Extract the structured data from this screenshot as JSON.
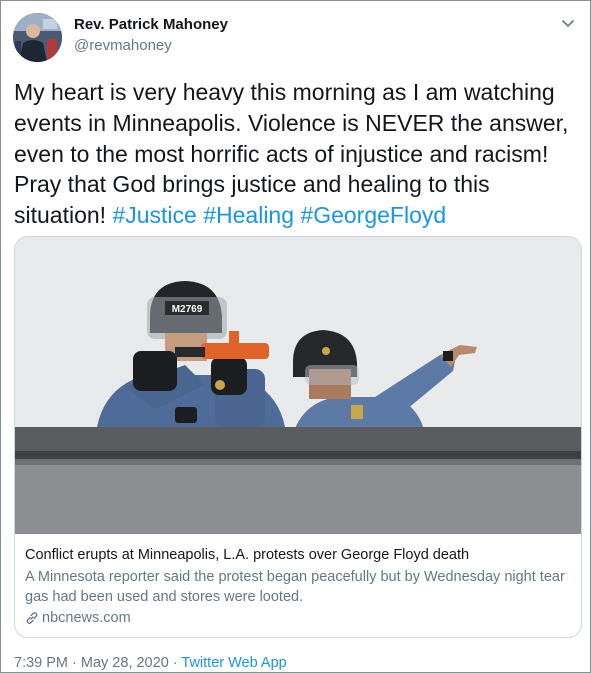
{
  "author": {
    "display_name": "Rev. Patrick Mahoney",
    "handle": "@revmahoney"
  },
  "tweet": {
    "text_before": "My heart is very heavy this morning as I am watching events in Minneapolis. Violence is NEVER the answer, even to the most horrific acts of injustice and racism! Pray that God brings justice and healing to this situation! ",
    "hashtags": [
      "#Justice",
      "#Healing",
      "#GeorgeFloyd"
    ]
  },
  "card": {
    "image_label": "M2769",
    "title": "Conflict erupts at Minneapolis, L.A. protests over George Floyd death",
    "description": "A Minnesota reporter said the protest began peacefully but by Wednesday night tear gas had been used and stores were looted.",
    "domain": "nbcnews.com"
  },
  "meta": {
    "time": "7:39 PM",
    "sep1": " · ",
    "date": "May 28, 2020",
    "sep2": " · ",
    "source": "Twitter Web App"
  },
  "icons": {
    "caret": "chevron-down-icon",
    "link": "link-icon"
  },
  "colors": {
    "link_blue": "#1b95e0",
    "secondary_text": "#657786"
  }
}
